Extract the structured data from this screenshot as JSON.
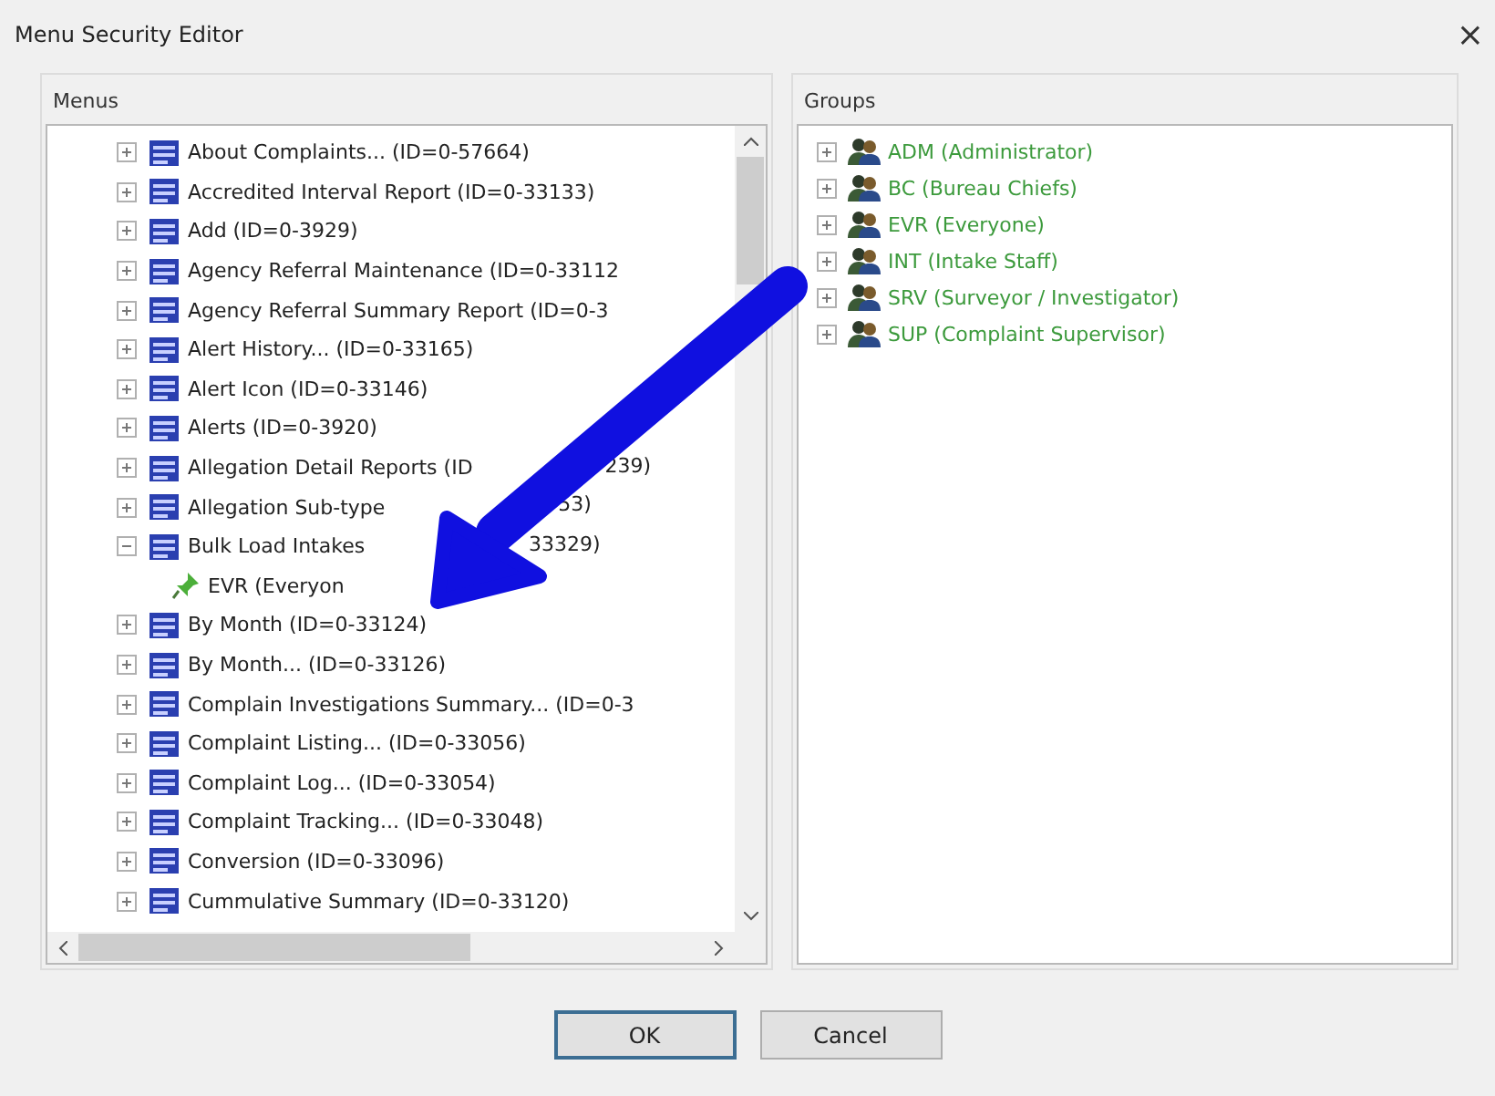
{
  "window": {
    "title": "Menu Security Editor",
    "close": "×"
  },
  "menus": {
    "label": "Menus",
    "items": [
      {
        "label": "About Complaints... (ID=0-57664)",
        "expanded": false
      },
      {
        "label": "Accredited Interval Report (ID=0-33133)",
        "expanded": false
      },
      {
        "label": "Add (ID=0-3929)",
        "expanded": false
      },
      {
        "label": "Agency Referral Maintenance (ID=0-33112",
        "expanded": false
      },
      {
        "label": "Agency Referral Summary Report (ID=0-3",
        "expanded": false
      },
      {
        "label": "Alert History... (ID=0-33165)",
        "expanded": false
      },
      {
        "label": "Alert Icon (ID=0-33146)",
        "expanded": false
      },
      {
        "label": "Alerts (ID=0-3920)",
        "expanded": false
      },
      {
        "label": "Allegation Detail Reports (ID",
        "label_tail": "239)",
        "expanded": false
      },
      {
        "label": "Allegation Sub-type",
        "label_tail": "53)",
        "expanded": false
      },
      {
        "label": "Bulk Load Intakes",
        "label_tail": "33329)",
        "expanded": true,
        "children": [
          {
            "label": "EVR (Everyon"
          }
        ]
      },
      {
        "label": "By Month (ID=0-33124)",
        "expanded": false
      },
      {
        "label": "By Month... (ID=0-33126)",
        "expanded": false
      },
      {
        "label": "Complain Investigations Summary... (ID=0-3",
        "expanded": false
      },
      {
        "label": "Complaint Listing... (ID=0-33056)",
        "expanded": false
      },
      {
        "label": "Complaint Log... (ID=0-33054)",
        "expanded": false
      },
      {
        "label": "Complaint Tracking... (ID=0-33048)",
        "expanded": false
      },
      {
        "label": "Conversion (ID=0-33096)",
        "expanded": false
      },
      {
        "label": "Cummulative Summary (ID=0-33120)",
        "expanded": false
      }
    ]
  },
  "groups": {
    "label": "Groups",
    "items": [
      {
        "label": "ADM (Administrator)",
        "expanded": false
      },
      {
        "label": "BC (Bureau Chiefs)",
        "expanded": false
      },
      {
        "label": "EVR (Everyone)",
        "expanded": false
      },
      {
        "label": "INT (Intake Staff)",
        "expanded": false
      },
      {
        "label": "SRV (Surveyor / Investigator)",
        "expanded": false
      },
      {
        "label": "SUP (Complaint Supervisor)",
        "expanded": false
      }
    ]
  },
  "buttons": [
    {
      "label": "OK",
      "default": true
    },
    {
      "label": "Cancel",
      "default": false
    }
  ]
}
